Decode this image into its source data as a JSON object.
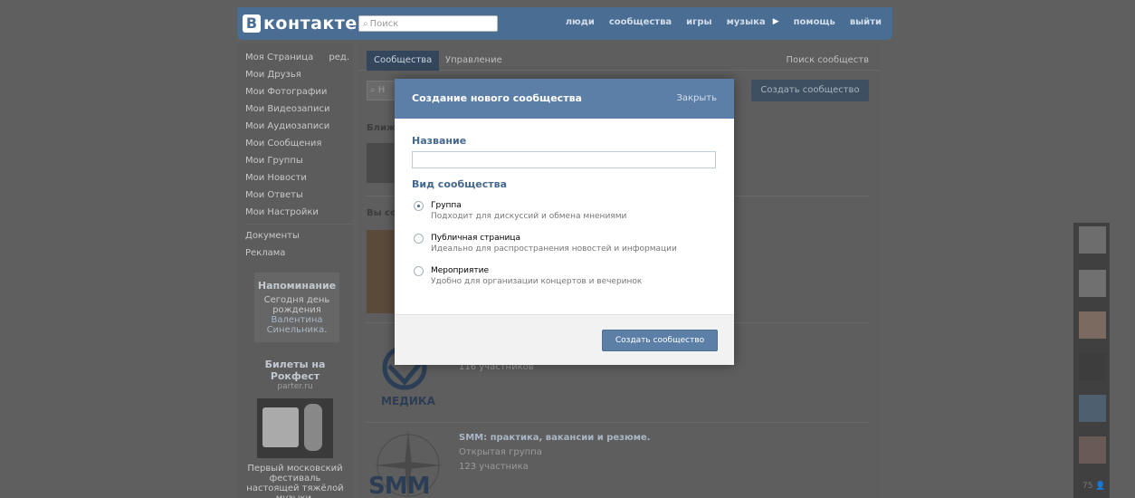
{
  "header": {
    "logo_letter": "В",
    "logo_text": "контакте",
    "search_placeholder": "Поиск",
    "nav": [
      "люди",
      "сообщества",
      "игры",
      "музыка",
      "помощь",
      "выйти"
    ]
  },
  "sidebar": {
    "items": [
      {
        "label": "Моя Страница",
        "extra": "ред."
      },
      {
        "label": "Мои Друзья"
      },
      {
        "label": "Мои Фотографии"
      },
      {
        "label": "Мои Видеозаписи"
      },
      {
        "label": "Мои Аудиозаписи"
      },
      {
        "label": "Мои Сообщения"
      },
      {
        "label": "Мои Группы"
      },
      {
        "label": "Мои Новости"
      },
      {
        "label": "Мои Ответы"
      },
      {
        "label": "Мои Настройки"
      }
    ],
    "extra_items": [
      {
        "label": "Документы"
      },
      {
        "label": "Реклама"
      }
    ],
    "reminder": {
      "title": "Напоминание",
      "text_before": "Сегодня день рождения ",
      "name": "Валентина Синельника",
      "text_after": "."
    },
    "ad": {
      "title": "Билеты на Рокфест",
      "source": "parter.ru",
      "text": "Первый московский фестиваль настоящей тяжёлой музыки."
    }
  },
  "main": {
    "tab_active": "Сообщества",
    "tab_other": "Управление",
    "tab_right": "Поиск сообществ",
    "search_partial": "Н",
    "create_button": "Создать сообщество",
    "section_near": "Ближ",
    "section_you": "Вы со",
    "groups": [
      {
        "name": "",
        "sub": "116 участников",
        "logo_text": "МЕДИКА"
      },
      {
        "name": "SMM: практика, вакансии и резюме.",
        "sub": "Открытая группа",
        "sub2": "123 участника",
        "logo_text": "SMM"
      }
    ]
  },
  "right_panel": {
    "count": "75"
  },
  "modal": {
    "title": "Создание нового сообщества",
    "close": "Закрыть",
    "name_label": "Название",
    "name_value": "",
    "type_label": "Вид сообщества",
    "options": [
      {
        "title": "Группа",
        "desc": "Подходит для дискуссий и обмена мнениями",
        "selected": true
      },
      {
        "title": "Публичная страница",
        "desc": "Идеально для распространения новостей и информации",
        "selected": false
      },
      {
        "title": "Мероприятие",
        "desc": "Удобно для организации концертов и вечеринок",
        "selected": false
      }
    ],
    "submit": "Создать сообщество"
  }
}
